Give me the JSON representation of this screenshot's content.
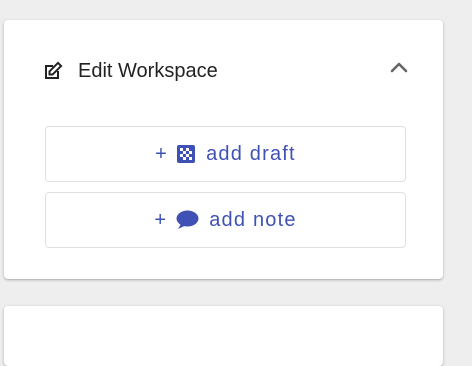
{
  "panel": {
    "title": "Edit Workspace",
    "buttons": {
      "draft": {
        "plus": "+",
        "label": "add draft"
      },
      "note": {
        "plus": "+",
        "label": "add note"
      }
    }
  },
  "icons": {
    "edit": "edit-icon",
    "collapse": "chevron-up-icon",
    "draft": "checkerboard-icon",
    "note": "speech-bubble-icon"
  },
  "colors": {
    "accent": "#3f51b5",
    "background": "#eeeeee",
    "card": "#ffffff",
    "border": "#e0e0e0"
  }
}
